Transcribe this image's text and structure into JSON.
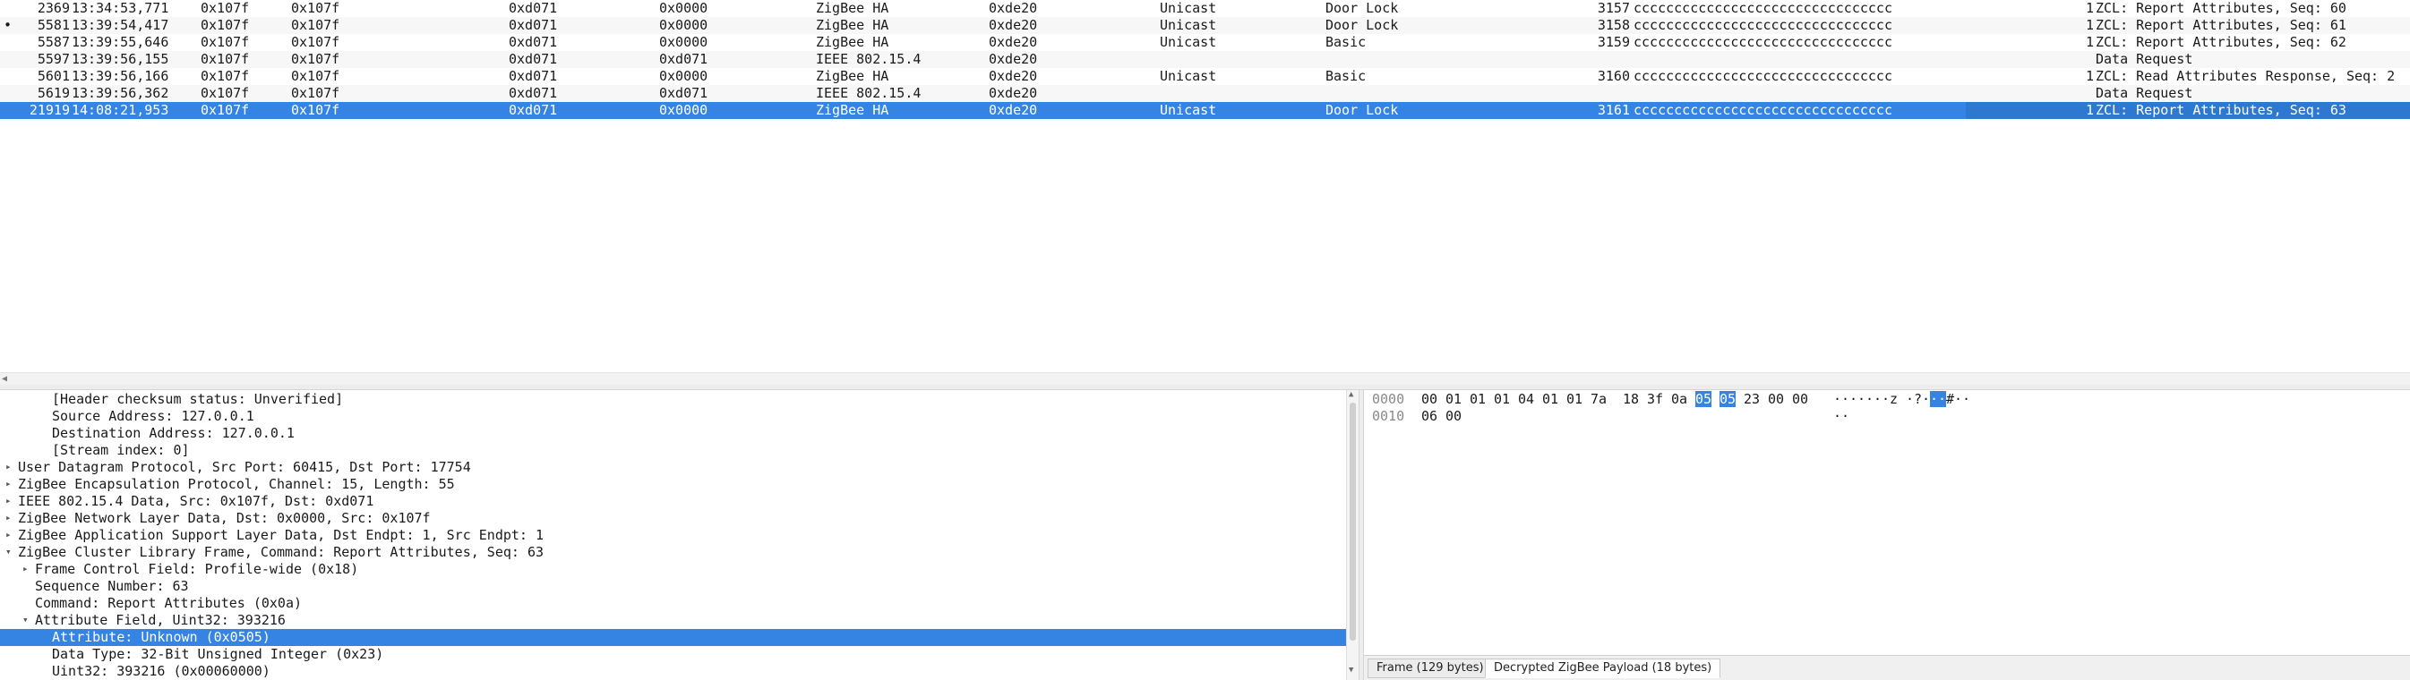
{
  "packet_list": {
    "rows": [
      {
        "mark": "",
        "no": "2369",
        "time": "13:34:53,771",
        "hw_src": "0x107f",
        "hw_dst": "0x107f",
        "src": "0xd071",
        "dst": "0x0000",
        "protocol": "ZigBee HA",
        "pan": "0xde20",
        "cast": "Unicast",
        "cluster": "Door Lock",
        "length": "3157",
        "data": "cccccccccccccccccccccccccccccccc",
        "frag": "1",
        "info": "ZCL: Report Attributes, Seq: 60",
        "selected": false
      },
      {
        "mark": "•",
        "no": "5581",
        "time": "13:39:54,417",
        "hw_src": "0x107f",
        "hw_dst": "0x107f",
        "src": "0xd071",
        "dst": "0x0000",
        "protocol": "ZigBee HA",
        "pan": "0xde20",
        "cast": "Unicast",
        "cluster": "Door Lock",
        "length": "3158",
        "data": "cccccccccccccccccccccccccccccccc",
        "frag": "1",
        "info": "ZCL: Report Attributes, Seq: 61",
        "selected": false
      },
      {
        "mark": "",
        "no": "5587",
        "time": "13:39:55,646",
        "hw_src": "0x107f",
        "hw_dst": "0x107f",
        "src": "0xd071",
        "dst": "0x0000",
        "protocol": "ZigBee HA",
        "pan": "0xde20",
        "cast": "Unicast",
        "cluster": "Basic",
        "length": "3159",
        "data": "cccccccccccccccccccccccccccccccc",
        "frag": "1",
        "info": "ZCL: Report Attributes, Seq: 62",
        "selected": false
      },
      {
        "mark": "",
        "no": "5597",
        "time": "13:39:56,155",
        "hw_src": "0x107f",
        "hw_dst": "0x107f",
        "src": "0xd071",
        "dst": "0xd071",
        "protocol": "IEEE 802.15.4",
        "pan": "0xde20",
        "cast": "",
        "cluster": "",
        "length": "",
        "data": "",
        "frag": "",
        "info": "Data Request",
        "selected": false
      },
      {
        "mark": "",
        "no": "5601",
        "time": "13:39:56,166",
        "hw_src": "0x107f",
        "hw_dst": "0x107f",
        "src": "0xd071",
        "dst": "0x0000",
        "protocol": "ZigBee HA",
        "pan": "0xde20",
        "cast": "Unicast",
        "cluster": "Basic",
        "length": "3160",
        "data": "cccccccccccccccccccccccccccccccc",
        "frag": "1",
        "info": "ZCL: Read Attributes Response, Seq: 2",
        "selected": false
      },
      {
        "mark": "",
        "no": "5619",
        "time": "13:39:56,362",
        "hw_src": "0x107f",
        "hw_dst": "0x107f",
        "src": "0xd071",
        "dst": "0xd071",
        "protocol": "IEEE 802.15.4",
        "pan": "0xde20",
        "cast": "",
        "cluster": "",
        "length": "",
        "data": "",
        "frag": "",
        "info": "Data Request",
        "selected": false
      },
      {
        "mark": "",
        "no": "21919",
        "time": "14:08:21,953",
        "hw_src": "0x107f",
        "hw_dst": "0x107f",
        "src": "0xd071",
        "dst": "0x0000",
        "protocol": "ZigBee HA",
        "pan": "0xde20",
        "cast": "Unicast",
        "cluster": "Door Lock",
        "length": "3161",
        "data": "cccccccccccccccccccccccccccccccc",
        "frag": "1",
        "info": "ZCL: Report Attributes, Seq: 63",
        "selected": true
      }
    ]
  },
  "details": {
    "rows": [
      {
        "level": 2,
        "arrow": "",
        "text": "[Header checksum status: Unverified]",
        "selected": false
      },
      {
        "level": 2,
        "arrow": "",
        "text": "Source Address: 127.0.0.1",
        "selected": false
      },
      {
        "level": 2,
        "arrow": "",
        "text": "Destination Address: 127.0.0.1",
        "selected": false
      },
      {
        "level": 2,
        "arrow": "",
        "text": "[Stream index: 0]",
        "selected": false
      },
      {
        "level": 0,
        "arrow": "▸",
        "text": "User Datagram Protocol, Src Port: 60415, Dst Port: 17754",
        "selected": false
      },
      {
        "level": 0,
        "arrow": "▸",
        "text": "ZigBee Encapsulation Protocol, Channel: 15, Length: 55",
        "selected": false
      },
      {
        "level": 0,
        "arrow": "▸",
        "text": "IEEE 802.15.4 Data, Src: 0x107f, Dst: 0xd071",
        "selected": false
      },
      {
        "level": 0,
        "arrow": "▸",
        "text": "ZigBee Network Layer Data, Dst: 0x0000, Src: 0x107f",
        "selected": false
      },
      {
        "level": 0,
        "arrow": "▸",
        "text": "ZigBee Application Support Layer Data, Dst Endpt: 1, Src Endpt: 1",
        "selected": false
      },
      {
        "level": 0,
        "arrow": "▾",
        "text": "ZigBee Cluster Library Frame, Command: Report Attributes, Seq: 63",
        "selected": false
      },
      {
        "level": 1,
        "arrow": "▸",
        "text": "Frame Control Field: Profile-wide (0x18)",
        "selected": false
      },
      {
        "level": 1,
        "arrow": "",
        "text": "Sequence Number: 63",
        "selected": false
      },
      {
        "level": 1,
        "arrow": "",
        "text": "Command: Report Attributes (0x0a)",
        "selected": false
      },
      {
        "level": 1,
        "arrow": "▾",
        "text": "Attribute Field, Uint32: 393216",
        "selected": false
      },
      {
        "level": 2,
        "arrow": "",
        "text": "Attribute: Unknown (0x0505)",
        "selected": true
      },
      {
        "level": 2,
        "arrow": "",
        "text": "Data Type: 32-Bit Unsigned Integer (0x23)",
        "selected": false
      },
      {
        "level": 2,
        "arrow": "",
        "text": "Uint32: 393216 (0x00060000)",
        "selected": false
      }
    ]
  },
  "bytes": {
    "rows": [
      {
        "offset": "0000",
        "hex": [
          {
            "v": "00",
            "hl": false
          },
          {
            "v": "01",
            "hl": false
          },
          {
            "v": "01",
            "hl": false
          },
          {
            "v": "01",
            "hl": false
          },
          {
            "v": "04",
            "hl": false
          },
          {
            "v": "01",
            "hl": false
          },
          {
            "v": "01",
            "hl": false
          },
          {
            "v": "7a",
            "hl": false
          },
          {
            "v": "18",
            "hl": false
          },
          {
            "v": "3f",
            "hl": false
          },
          {
            "v": "0a",
            "hl": false
          },
          {
            "v": "05",
            "hl": true
          },
          {
            "v": "05",
            "hl": true
          },
          {
            "v": "23",
            "hl": false
          },
          {
            "v": "00",
            "hl": false
          },
          {
            "v": "00",
            "hl": false
          }
        ],
        "ascii": [
          {
            "v": "·",
            "hl": false
          },
          {
            "v": "·",
            "hl": false
          },
          {
            "v": "·",
            "hl": false
          },
          {
            "v": "·",
            "hl": false
          },
          {
            "v": "·",
            "hl": false
          },
          {
            "v": "·",
            "hl": false
          },
          {
            "v": "·",
            "hl": false
          },
          {
            "v": "z",
            "hl": false
          },
          {
            "v": "·",
            "hl": false
          },
          {
            "v": "?",
            "hl": false
          },
          {
            "v": "·",
            "hl": false
          },
          {
            "v": "·",
            "hl": true
          },
          {
            "v": "·",
            "hl": true
          },
          {
            "v": "#",
            "hl": false
          },
          {
            "v": "·",
            "hl": false
          },
          {
            "v": "·",
            "hl": false
          }
        ]
      },
      {
        "offset": "0010",
        "hex": [
          {
            "v": "06",
            "hl": false
          },
          {
            "v": "00",
            "hl": false
          }
        ],
        "ascii": [
          {
            "v": "·",
            "hl": false
          },
          {
            "v": "·",
            "hl": false
          }
        ]
      }
    ],
    "tabs": [
      {
        "label": "Frame (129 bytes)",
        "active": false
      },
      {
        "label": "Decrypted ZigBee Payload (18 bytes)",
        "active": true
      }
    ]
  },
  "colors": {
    "selection": "#3584e4",
    "alt_row": "#f7f7f7"
  }
}
